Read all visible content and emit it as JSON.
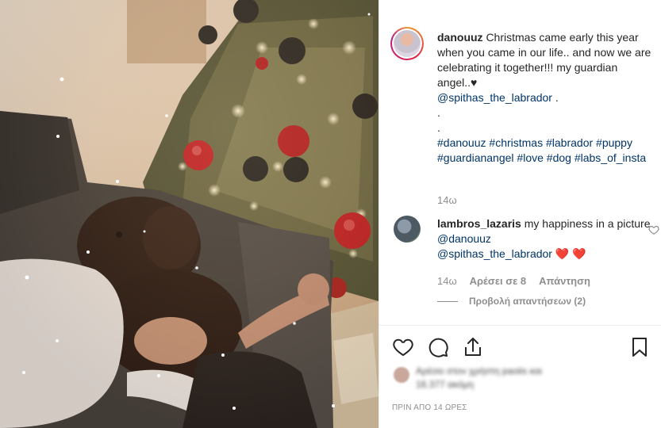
{
  "post": {
    "username": "danouuz",
    "caption_line1": "Christmas came early this year when you came in our life.. and now we are celebrating it together!!! my guardian angel..♥",
    "mention": "@spithas_the_labrador",
    "mention_suffix": " .",
    "dot_line1": ".",
    "dot_line2": ".",
    "hashtags": [
      "#danouuz",
      "#christmas",
      "#labrador",
      "#puppy",
      "#guardianangel",
      "#love",
      "#dog",
      "#labs_of_insta"
    ],
    "time": "14ω"
  },
  "comment": {
    "username": "lambros_lazaris",
    "text": "my happiness in a picture",
    "mention1": "@danouuz",
    "mention2": "@spithas_the_labrador",
    "hearts": "❤️ ❤️",
    "time": "14ω",
    "likes_label": "Αρέσει σε 8",
    "reply_label": "Απάντηση",
    "view_replies": "Προβολή απαντήσεων (2)"
  },
  "likes_blurred": {
    "line1": "Αρέσει στον χρήστη paoiis και",
    "line2": "16.377 ακόμη"
  },
  "posted_ago": "ΠΡΙΝ ΑΠΟ 14 ΩΡΕΣ",
  "colors": {
    "link": "#003569",
    "muted": "#8e8e8e",
    "heart": "#e0245e",
    "ornament_red": "#c0181f"
  },
  "icons": [
    "heart-icon",
    "comment-icon",
    "share-icon",
    "bookmark-icon"
  ]
}
